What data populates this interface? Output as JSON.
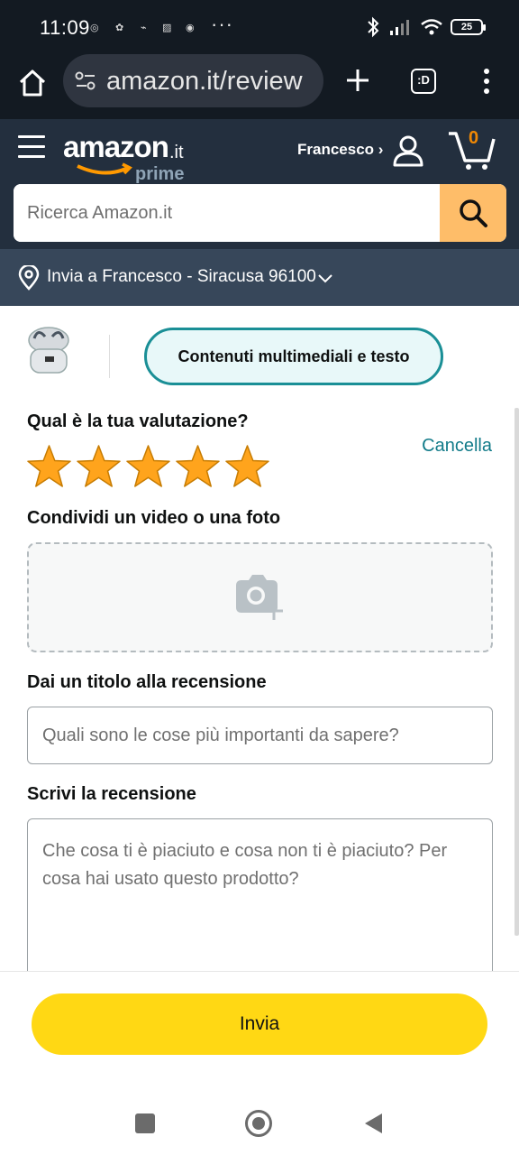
{
  "status_bar": {
    "time": "11:09",
    "more": "···",
    "battery": "25"
  },
  "browser": {
    "url": "amazon.it/review",
    "tabs_label": ":D"
  },
  "header": {
    "logo_word": "amazon",
    "logo_tld": ".it",
    "logo_prime": "prime",
    "account_name": "Francesco ›",
    "cart_count": "0",
    "search_placeholder": "Ricerca Amazon.it",
    "deliver_to": "Invia a Francesco - Siracusa 96100"
  },
  "review": {
    "media_tab": "Contenuti multimediali e testo",
    "rating_title": "Qual è la tua valutazione?",
    "cancel": "Cancella",
    "stars": 5,
    "star_color": "#ffa41c",
    "share_title": "Condividi un video o una foto",
    "headline_title": "Dai un titolo alla recensione",
    "headline_placeholder": "Quali sono le cose più importanti da sapere?",
    "body_title": "Scrivi la recensione",
    "body_placeholder": "Che cosa ti è piaciuto e cosa non ti è piaciuto? Per cosa hai usato questo prodotto?",
    "submit": "Invia"
  },
  "colors": {
    "header_bg": "#232f3e",
    "search_button": "#febd69",
    "accent_teal": "#1a8f96",
    "submit_yellow": "#ffd814"
  }
}
